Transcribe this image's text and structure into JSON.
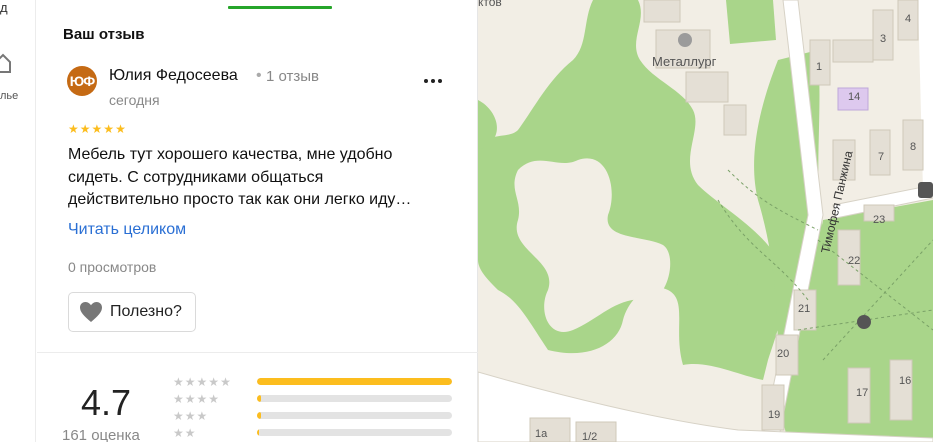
{
  "rail": {
    "top_text": "д",
    "bottom_text": "лье"
  },
  "panel": {
    "title": "Ваш отзыв"
  },
  "review": {
    "avatar_initials": "ЮФ",
    "author": "Юлия Федосеева",
    "separator": "•",
    "author_reviews": "1 отзыв",
    "date": "сегодня",
    "rating_stars": 5,
    "text_lines": [
      "Мебель тут хорошего качества, мне удобно",
      "сидеть. С сотрудниками общаться",
      "действительно просто так как они легко иду…"
    ],
    "read_more": "Читать целиком",
    "views": "0 просмотров",
    "useful_label": "Полезно?"
  },
  "summary": {
    "rating": "4.7",
    "count": "161 оценка",
    "distribution": [
      {
        "stars": 5,
        "fill": 1.0
      },
      {
        "stars": 4,
        "fill": 0.02
      },
      {
        "stars": 3,
        "fill": 0.02
      },
      {
        "stars": 2,
        "fill": 0.01
      }
    ]
  },
  "map": {
    "labels": {
      "top_fragment": "ктов",
      "metallurg": "Металлург",
      "street": "Тимофея Панжина",
      "houses": [
        "3",
        "4",
        "1",
        "14",
        "7",
        "8",
        "23",
        "22",
        "21",
        "20",
        "17",
        "16",
        "19",
        "1а",
        "1/2"
      ]
    },
    "colors": {
      "background": "#f2eee5",
      "park": "#a9d58a",
      "road": "#ffffff",
      "building": "#e4dfd5",
      "building_highlight": "#ddc9ee"
    }
  }
}
